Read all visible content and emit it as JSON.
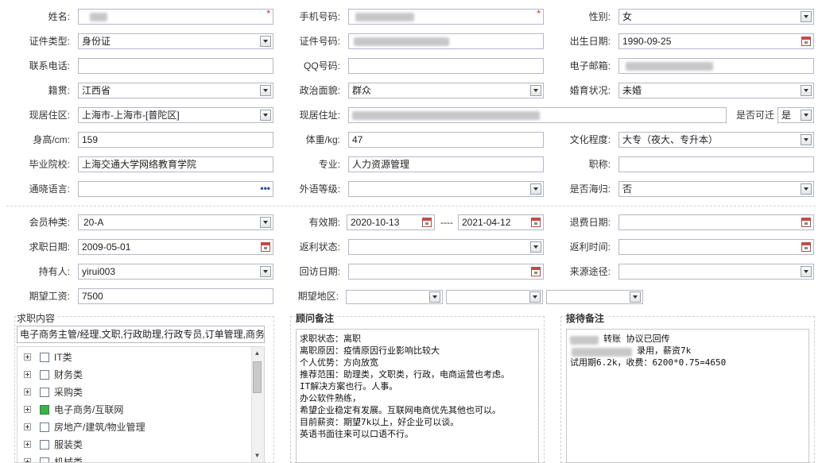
{
  "row1": {
    "name_label": "姓名:",
    "phone_label": "手机号码:",
    "gender_label": "性别:",
    "gender_value": "女",
    "required_mark": "*"
  },
  "row2": {
    "idtype_label": "证件类型:",
    "idtype_value": "身份证",
    "idno_label": "证件号码:",
    "birth_label": "出生日期:",
    "birth_value": "1990-09-25"
  },
  "row3": {
    "tel_label": "联系电话:",
    "qq_label": "QQ号码:",
    "email_label": "电子邮箱:"
  },
  "row4": {
    "native_label": "籍贯:",
    "native_value": "江西省",
    "political_label": "政治面貌:",
    "political_value": "群众",
    "marital_label": "婚育状况:",
    "marital_value": "未婚"
  },
  "row5": {
    "area_label": "现居住区:",
    "area_value": "上海市-上海市-[普陀区]",
    "address_label": "现居住址:",
    "transferable_label": "是否可迁",
    "transferable_value": "是"
  },
  "row6": {
    "height_label": "身高/cm:",
    "height_value": "159",
    "weight_label": "体重/kg:",
    "weight_value": "47",
    "education_label": "文化程度:",
    "education_value": "大专（夜大、专升本）"
  },
  "row7": {
    "school_label": "毕业院校:",
    "school_value": "上海交通大学网络教育学院",
    "major_label": "专业:",
    "major_value": "人力资源管理",
    "title_label": "职称:"
  },
  "row8": {
    "language_label": "通晓语言:",
    "language_more": "•••",
    "foreign_label": "外语等级:",
    "overseas_label": "是否海归:",
    "overseas_value": "否"
  },
  "row9": {
    "member_label": "会员种类:",
    "member_value": "20-A",
    "valid_label": "有效期:",
    "valid_from": "2020-10-13",
    "valid_sep": "----",
    "valid_to": "2021-04-12",
    "refund_date_label": "退费日期:"
  },
  "row10": {
    "job_date_label": "求职日期:",
    "job_date_value": "2009-05-01",
    "rebate_status_label": "返利状态:",
    "rebate_time_label": "返利时间:"
  },
  "row11": {
    "holder_label": "持有人:",
    "holder_value": "yirui003",
    "visit_date_label": "回访日期:",
    "source_label": "来源途径:"
  },
  "row12": {
    "salary_label": "期望工资:",
    "salary_value": "7500",
    "region_label": "期望地区:"
  },
  "job_panel": {
    "title": "求职内容",
    "summary": "电子商务主管/经理,文职,行政助理,行政专员,订单管理,商务",
    "categories": [
      {
        "label": "IT类",
        "checked": false
      },
      {
        "label": "财务类",
        "checked": false
      },
      {
        "label": "采购类",
        "checked": false
      },
      {
        "label": "电子商务/互联网",
        "checked": true
      },
      {
        "label": "房地产/建筑/物业管理",
        "checked": false
      },
      {
        "label": "服装类",
        "checked": false
      },
      {
        "label": "机械类",
        "checked": false
      }
    ]
  },
  "advisor_panel": {
    "title": "顾问备注",
    "lines": [
      "求职状态：离职",
      "离职原因：疫情原因行业影响比较大",
      "个人优势：方向放宽",
      "推荐范围：助理类，文职类，行政，电商运营也考虑。",
      "IT解决方案也行。人事。",
      "办公软件熟练，",
      "希望企业稳定有发展。互联网电商优先其他也可以。",
      "目前薪资：期望7k以上，好企业可以谈。",
      "英语书面往来可以口语不行。"
    ]
  },
  "reception_panel": {
    "title": "接待备注",
    "line1_text": "转账 协议已回传",
    "line2_text": "录用，薪资7k",
    "line3_text": "试用期6.2k，收费：6200*0.75=4650"
  }
}
